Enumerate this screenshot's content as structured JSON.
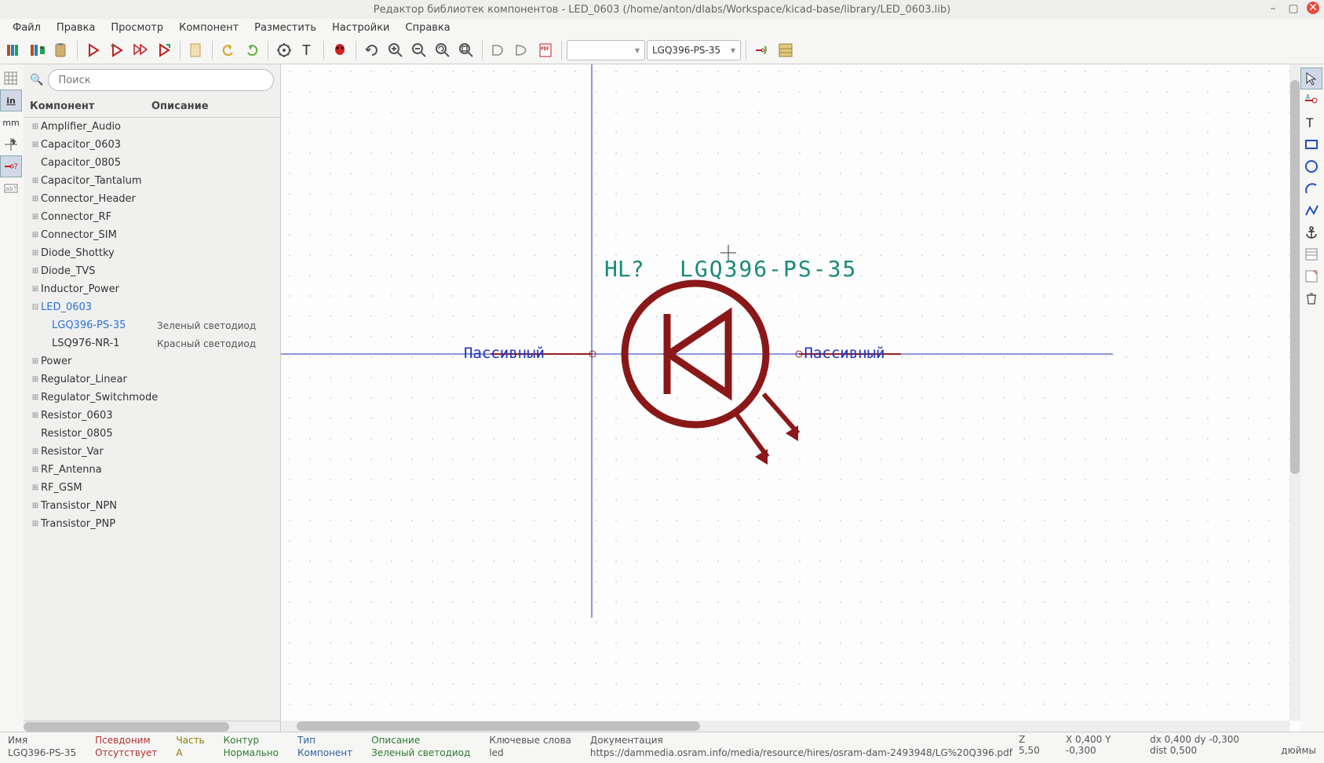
{
  "title": "Редактор библиотек компонентов - LED_0603 (/home/anton/dlabs/Workspace/kicad-base/library/LED_0603.lib)",
  "menu": {
    "file": "Файл",
    "edit": "Правка",
    "view": "Просмотр",
    "component": "Компонент",
    "place": "Разместить",
    "settings": "Настройки",
    "help": "Справка"
  },
  "toolbar": {
    "part_combo": "",
    "component_combo": "LGQ396-PS-35"
  },
  "search": {
    "placeholder": "Поиск"
  },
  "tree": {
    "col_name": "Компонент",
    "col_desc": "Описание",
    "items": [
      {
        "name": "Amplifier_Audio",
        "desc": "",
        "level": 0,
        "expanded": false
      },
      {
        "name": "Capacitor_0603",
        "desc": "",
        "level": 0,
        "expanded": false
      },
      {
        "name": "Capacitor_0805",
        "desc": "",
        "level": 0,
        "expanded": null
      },
      {
        "name": "Capacitor_Tantalum",
        "desc": "",
        "level": 0,
        "expanded": false
      },
      {
        "name": "Connector_Header",
        "desc": "",
        "level": 0,
        "expanded": false
      },
      {
        "name": "Connector_RF",
        "desc": "",
        "level": 0,
        "expanded": false
      },
      {
        "name": "Connector_SIM",
        "desc": "",
        "level": 0,
        "expanded": false
      },
      {
        "name": "Diode_Shottky",
        "desc": "",
        "level": 0,
        "expanded": false
      },
      {
        "name": "Diode_TVS",
        "desc": "",
        "level": 0,
        "expanded": false
      },
      {
        "name": "Inductor_Power",
        "desc": "",
        "level": 0,
        "expanded": false
      },
      {
        "name": "LED_0603",
        "desc": "",
        "level": 0,
        "expanded": true,
        "selected": true
      },
      {
        "name": "LGQ396-PS-35",
        "desc": "Зеленый светодиод",
        "level": 1,
        "selected": true
      },
      {
        "name": "LSQ976-NR-1",
        "desc": "Красный светодиод",
        "level": 1
      },
      {
        "name": "Power",
        "desc": "",
        "level": 0,
        "expanded": false
      },
      {
        "name": "Regulator_Linear",
        "desc": "",
        "level": 0,
        "expanded": false
      },
      {
        "name": "Regulator_Switchmode",
        "desc": "",
        "level": 0,
        "expanded": false
      },
      {
        "name": "Resistor_0603",
        "desc": "",
        "level": 0,
        "expanded": false
      },
      {
        "name": "Resistor_0805",
        "desc": "",
        "level": 0,
        "expanded": null
      },
      {
        "name": "Resistor_Var",
        "desc": "",
        "level": 0,
        "expanded": false
      },
      {
        "name": "RF_Antenna",
        "desc": "",
        "level": 0,
        "expanded": false
      },
      {
        "name": "RF_GSM",
        "desc": "",
        "level": 0,
        "expanded": false
      },
      {
        "name": "Transistor_NPN",
        "desc": "",
        "level": 0,
        "expanded": false
      },
      {
        "name": "Transistor_PNP",
        "desc": "",
        "level": 0,
        "expanded": false
      }
    ]
  },
  "canvas": {
    "ref": "HL?",
    "value": "LGQ396-PS-35",
    "pin1_type": "Пассивный",
    "pin2_type": "Пассивный"
  },
  "status": {
    "name_lbl": "Имя",
    "name_val": "LGQ396-PS-35",
    "alias_lbl": "Псевдоним",
    "alias_val": "Отсутствует",
    "part_lbl": "Часть",
    "part_val": "A",
    "body_lbl": "Контур",
    "body_val": "Нормально",
    "type_lbl": "Тип",
    "type_val": "Компонент",
    "desc_lbl": "Описание",
    "desc_val": "Зеленый светодиод",
    "keywords_lbl": "Ключевые слова",
    "keywords_val": "led",
    "doc_lbl": "Документация",
    "doc_val": "https://dammedia.osram.info/media/resource/hires/osram-dam-2493948/LG%20Q396.pdf",
    "z": "Z 5,50",
    "xy": "X 0,400  Y -0,300",
    "dxy": "dx 0,400  dy -0,300  dist 0,500",
    "units": "дюймы"
  }
}
